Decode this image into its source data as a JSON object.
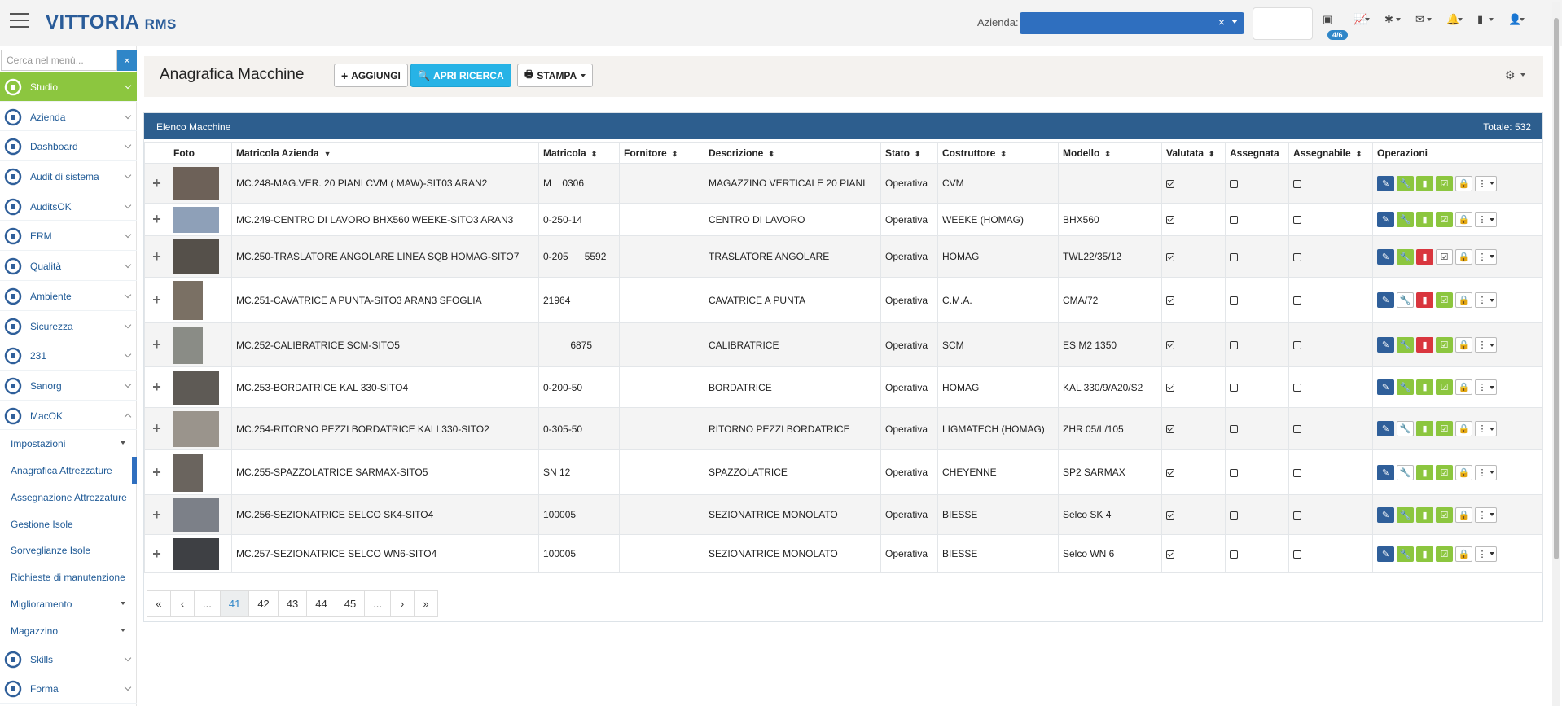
{
  "header": {
    "logo_main": "VITTORIA",
    "logo_sub": "RMS",
    "azienda_label": "Azienda:",
    "azienda_value": "",
    "notifications_badge": "4/6",
    "icons": [
      "inbox-icon",
      "chart-icon",
      "bug-icon",
      "mail-icon",
      "bell-icon",
      "battery-icon",
      "user-icon"
    ]
  },
  "sidebar": {
    "search_placeholder": "Cerca nel menù...",
    "items": [
      {
        "label": "Studio",
        "icon": "studio-icon",
        "active": true
      },
      {
        "label": "Azienda",
        "icon": "building-icon"
      },
      {
        "label": "Dashboard",
        "icon": "dashboard-icon"
      },
      {
        "label": "Audit di sistema",
        "icon": "audit-icon"
      },
      {
        "label": "AuditsOK",
        "icon": "auditsok-icon"
      },
      {
        "label": "ERM",
        "icon": "erm-icon"
      },
      {
        "label": "Qualità",
        "icon": "quality-icon"
      },
      {
        "label": "Ambiente",
        "icon": "environment-icon"
      },
      {
        "label": "Sicurezza",
        "icon": "safety-icon"
      },
      {
        "label": "231",
        "icon": "law-icon"
      },
      {
        "label": "Sanorg",
        "icon": "health-icon"
      },
      {
        "label": "MacOK",
        "icon": "macok-gear-icon",
        "open": true
      }
    ],
    "subitems": [
      {
        "label": "Impostazioni",
        "caret": true
      },
      {
        "label": "Anagrafica Attrezzature",
        "current": true
      },
      {
        "label": "Assegnazione Attrezzature"
      },
      {
        "label": "Gestione Isole"
      },
      {
        "label": "Sorveglianze Isole"
      },
      {
        "label": "Richieste di manutenzione"
      },
      {
        "label": "Miglioramento",
        "caret": true
      },
      {
        "label": "Magazzino",
        "caret": true
      }
    ],
    "items_after": [
      {
        "label": "Skills",
        "icon": "skills-icon"
      },
      {
        "label": "Forma",
        "icon": "training-icon"
      }
    ]
  },
  "page": {
    "title": "Anagrafica Macchine",
    "add_label": "AGGIUNGI",
    "search_label": "APRI RICERCA",
    "print_label": "STAMPA"
  },
  "panel": {
    "title": "Elenco Macchine",
    "total": "Totale: 532"
  },
  "table": {
    "columns": [
      "",
      "Foto",
      "Matricola Azienda",
      "Matricola",
      "Fornitore",
      "Descrizione",
      "Stato",
      "Costruttore",
      "Modello",
      "Valutata",
      "Assegnata",
      "Assegnabile",
      "Operazioni"
    ],
    "rows": [
      {
        "code": "MC.248-MAG.VER. 20 PIANI CVM ( MAW)-SIT03 ARAN2",
        "matricola": "M    0306",
        "fornitore": "",
        "descrizione": "MAGAZZINO VERTICALE 20 PIANI",
        "stato": "Operativa",
        "costruttore": "CVM",
        "modello": "",
        "valutata": true,
        "assegnata": false,
        "assegnabile": false,
        "ops": [
          "edit",
          "wr-g",
          "ch-g",
          "ok-g",
          "lock",
          "more"
        ],
        "photo_bg": "#6d6158"
      },
      {
        "code": "MC.249-CENTRO DI LAVORO BHX560 WEEKE-SITO3 ARAN3",
        "matricola": "0-250-14",
        "fornitore": "",
        "descrizione": "CENTRO DI LAVORO",
        "stato": "Operativa",
        "costruttore": "WEEKE (HOMAG)",
        "modello": "BHX560",
        "valutata": true,
        "assegnata": false,
        "assegnabile": false,
        "ops": [
          "edit",
          "wr-g",
          "ch-g",
          "ok-g",
          "lock",
          "more"
        ],
        "photo_bg": "#8ea0b8"
      },
      {
        "code": "MC.250-TRASLATORE ANGOLARE LINEA SQB HOMAG-SITO7",
        "matricola": "0-205      5592",
        "fornitore": "",
        "descrizione": "TRASLATORE ANGOLARE",
        "stato": "Operativa",
        "costruttore": "HOMAG",
        "modello": "TWL22/35/12",
        "valutata": true,
        "assegnata": false,
        "assegnabile": false,
        "ops": [
          "edit",
          "wr-g",
          "ch-r",
          "ok-w",
          "lock",
          "more"
        ],
        "photo_bg": "#55504a"
      },
      {
        "code": "MC.251-CAVATRICE A PUNTA-SITO3 ARAN3 SFOGLIA",
        "matricola": "21964",
        "fornitore": "",
        "descrizione": "CAVATRICE A PUNTA",
        "stato": "Operativa",
        "costruttore": "C.M.A.",
        "modello": "CMA/72",
        "valutata": true,
        "assegnata": false,
        "assegnabile": false,
        "ops": [
          "edit",
          "wr-w",
          "ch-r",
          "ok-g",
          "lock",
          "more"
        ],
        "photo_bg": "#7a7064"
      },
      {
        "code": "MC.252-CALIBRATRICE SCM-SITO5",
        "matricola": "          6875",
        "fornitore": "",
        "descrizione": "CALIBRATRICE",
        "stato": "Operativa",
        "costruttore": "SCM",
        "modello": "ES M2 1350",
        "valutata": true,
        "assegnata": false,
        "assegnabile": false,
        "ops": [
          "edit",
          "wr-g",
          "ch-r",
          "ok-g",
          "lock",
          "more"
        ],
        "photo_bg": "#8a8c86"
      },
      {
        "code": "MC.253-BORDATRICE KAL 330-SITO4",
        "matricola": "0-200-50",
        "fornitore": "",
        "descrizione": "BORDATRICE",
        "stato": "Operativa",
        "costruttore": "HOMAG",
        "modello": "KAL 330/9/A20/S2",
        "valutata": true,
        "assegnata": false,
        "assegnabile": false,
        "ops": [
          "edit",
          "wr-g",
          "ch-g",
          "ok-g",
          "lock",
          "more"
        ],
        "photo_bg": "#5e5a55"
      },
      {
        "code": "MC.254-RITORNO PEZZI BORDATRICE KALL330-SITO2",
        "matricola": "0-305-50",
        "fornitore": "",
        "descrizione": "RITORNO PEZZI BORDATRICE",
        "stato": "Operativa",
        "costruttore": "LIGMATECH (HOMAG)",
        "modello": "ZHR 05/L/105",
        "valutata": true,
        "assegnata": false,
        "assegnabile": false,
        "ops": [
          "edit",
          "wr-w",
          "ch-g",
          "ok-g",
          "lock",
          "more"
        ],
        "photo_bg": "#9a948c"
      },
      {
        "code": "MC.255-SPAZZOLATRICE SARMAX-SITO5",
        "matricola": "SN 12",
        "fornitore": "",
        "descrizione": "SPAZZOLATRICE",
        "stato": "Operativa",
        "costruttore": "CHEYENNE",
        "modello": "SP2 SARMAX",
        "valutata": true,
        "assegnata": false,
        "assegnabile": false,
        "ops": [
          "edit",
          "wr-w",
          "ch-g",
          "ok-g",
          "lock",
          "more"
        ],
        "photo_bg": "#6a645e"
      },
      {
        "code": "MC.256-SEZIONATRICE SELCO SK4-SITO4",
        "matricola": "100005",
        "fornitore": "",
        "descrizione": "SEZIONATRICE MONOLATO",
        "stato": "Operativa",
        "costruttore": "BIESSE",
        "modello": "Selco SK 4",
        "valutata": true,
        "assegnata": false,
        "assegnabile": false,
        "ops": [
          "edit",
          "wr-g",
          "ch-g",
          "ok-g",
          "lock",
          "more"
        ],
        "photo_bg": "#7c8088"
      },
      {
        "code": "MC.257-SEZIONATRICE SELCO WN6-SITO4",
        "matricola": "100005",
        "fornitore": "",
        "descrizione": "SEZIONATRICE MONOLATO",
        "stato": "Operativa",
        "costruttore": "BIESSE",
        "modello": "Selco WN 6",
        "valutata": true,
        "assegnata": false,
        "assegnabile": false,
        "ops": [
          "edit",
          "wr-g",
          "ch-g",
          "ok-g",
          "lock",
          "more"
        ],
        "photo_bg": "#3e4044"
      }
    ]
  },
  "pagination": [
    "«",
    "‹",
    "...",
    "41",
    "42",
    "43",
    "44",
    "45",
    "...",
    "›",
    "»"
  ],
  "pagination_active": "41",
  "colors": {
    "primary": "#2d5e8e",
    "accent": "#27b3e6",
    "green": "#8cc63f",
    "red": "#d9363e"
  }
}
